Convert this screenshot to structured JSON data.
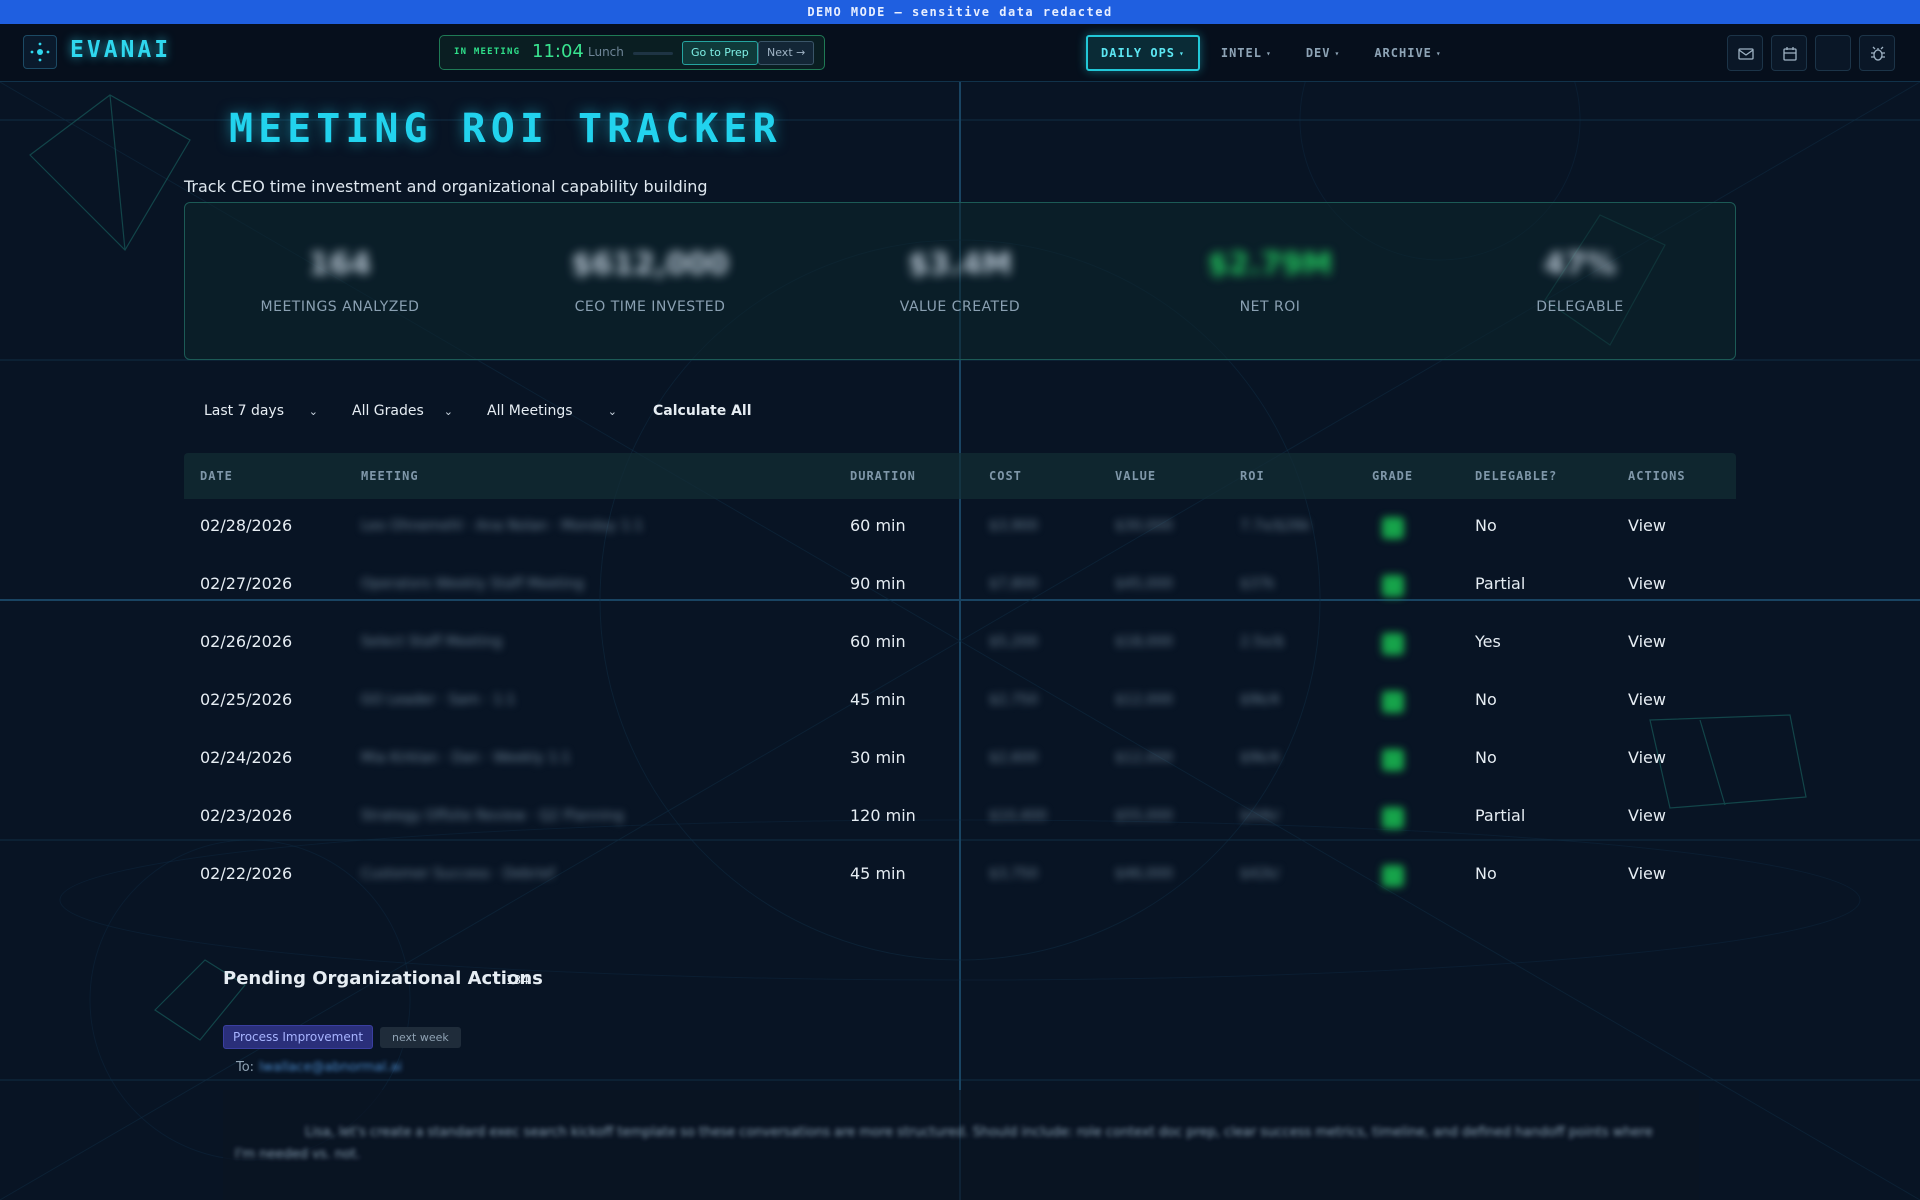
{
  "banner": {
    "text": "DEMO MODE — sensitive data redacted"
  },
  "header": {
    "logo_text": "EVANAI",
    "meeting": {
      "status": "IN MEETING",
      "time": "11:04",
      "title": "Lunch",
      "prep_button": "Go to Prep",
      "next_button": "Next →"
    },
    "nav": [
      {
        "label": "DAILY OPS",
        "active": true
      },
      {
        "label": "INTEL",
        "active": false
      },
      {
        "label": "DEV",
        "active": false
      },
      {
        "label": "ARCHIVE",
        "active": false
      }
    ],
    "icons": [
      "mail-icon",
      "calendar-icon",
      "blank-icon",
      "bug-icon"
    ]
  },
  "page": {
    "title": "MEETING ROI TRACKER",
    "subtitle": "Track CEO time investment and organizational capability building"
  },
  "stats": [
    {
      "value": "164",
      "label": "MEETINGS ANALYZED"
    },
    {
      "value": "$612,000",
      "label": "CEO TIME INVESTED"
    },
    {
      "value": "$3.4M",
      "label": "VALUE CREATED"
    },
    {
      "value": "$2.79M",
      "label": "NET ROI",
      "positive": true
    },
    {
      "value": "47%",
      "label": "DELEGABLE"
    }
  ],
  "filters": {
    "range": "Last 7 days",
    "grades": "All Grades",
    "meetings": "All Meetings",
    "calculate": "Calculate All"
  },
  "table": {
    "columns": [
      "DATE",
      "MEETING",
      "DURATION",
      "COST",
      "VALUE",
      "ROI",
      "GRADE",
      "DELEGABLE?",
      "ACTIONS"
    ],
    "rows": [
      {
        "date": "02/28/2026",
        "meeting": "Leo Ohnemehl · Ana Nolan · Monday 1:1",
        "duration": "60 min",
        "cost": "$3,900",
        "value": "$30,000",
        "roi": "7.7x/$26k",
        "delegable": "No",
        "action": "View"
      },
      {
        "date": "02/27/2026",
        "meeting": "Operators Weekly Staff Meeting",
        "duration": "90 min",
        "cost": "$7,800",
        "value": "$45,000",
        "roi": "$37k",
        "delegable": "Partial",
        "action": "View"
      },
      {
        "date": "02/26/2026",
        "meeting": "Select Staff Meeting",
        "duration": "60 min",
        "cost": "$5,200",
        "value": "$18,000",
        "roi": "2.5x/$",
        "delegable": "Yes",
        "action": "View"
      },
      {
        "date": "02/25/2026",
        "meeting": "GO Leader · Sam · 1:1",
        "duration": "45 min",
        "cost": "$2,750",
        "value": "$12,000",
        "roi": "$9k/4",
        "delegable": "No",
        "action": "View"
      },
      {
        "date": "02/24/2026",
        "meeting": "Mia Kirklan · Dan · Weekly 1:1",
        "duration": "30 min",
        "cost": "$2,600",
        "value": "$12,000",
        "roi": "$9k/4",
        "delegable": "No",
        "action": "View"
      },
      {
        "date": "02/23/2026",
        "meeting": "Strategy Offsite Review · Q2 Planning",
        "duration": "120 min",
        "cost": "$10,400",
        "value": "$55,000",
        "roi": "$44k/",
        "delegable": "Partial",
        "action": "View"
      },
      {
        "date": "02/22/2026",
        "meeting": "Customer Success · Debrief",
        "duration": "45 min",
        "cost": "$3,750",
        "value": "$46,000",
        "roi": "$42k/",
        "delegable": "No",
        "action": "View"
      }
    ]
  },
  "pending": {
    "title": "Pending Organizational Actions",
    "count": "134",
    "tag": "Process Improvement",
    "when": "next week",
    "to_label": "To:",
    "to_email": "lwallace@abnormal.ai",
    "message": "Lisa, let's create a standard exec search kickoff template so these conversations are more structured. Should include: role context doc prep, clear success metrics, timeline, and defined handoff points where I'm needed vs. not."
  },
  "colors": {
    "accent": "#22d3ee",
    "banner": "#1f5fe0",
    "positive": "#22c55e",
    "tag": "#2a2f7a"
  }
}
